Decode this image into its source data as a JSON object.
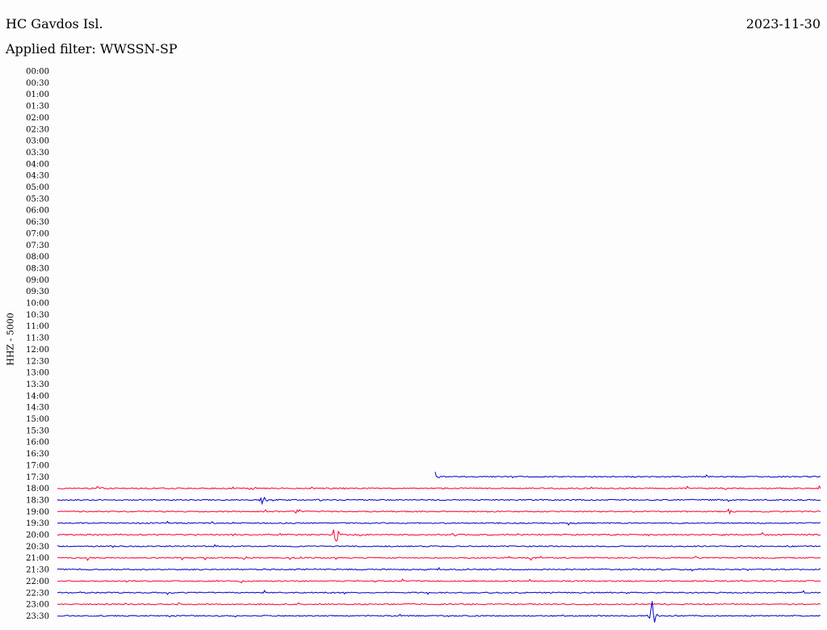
{
  "header": {
    "station": "HC Gavdos Isl.",
    "date": "2023-11-30",
    "filter_text": "Applied filter: WWSSN-SP",
    "channel": "HHZ - 5000"
  },
  "chart_data": {
    "type": "helicorder",
    "y_ticks": [
      "00:00",
      "00:30",
      "01:00",
      "01:30",
      "02:00",
      "02:30",
      "03:00",
      "03:30",
      "04:00",
      "04:30",
      "05:00",
      "05:30",
      "06:00",
      "06:30",
      "07:00",
      "07:30",
      "08:00",
      "08:30",
      "09:00",
      "09:30",
      "10:00",
      "10:30",
      "11:00",
      "11:30",
      "12:00",
      "12:30",
      "13:00",
      "13:30",
      "14:00",
      "14:30",
      "15:00",
      "15:30",
      "16:00",
      "16:30",
      "17:00",
      "17:30",
      "18:00",
      "18:30",
      "19:00",
      "19:30",
      "20:00",
      "20:30",
      "21:00",
      "21:30",
      "22:00",
      "22:30",
      "23:00",
      "23:30"
    ],
    "colors": [
      "#ff0033",
      "#0000cc"
    ],
    "traces": [
      {
        "row": "17:30",
        "start": 0.495,
        "events": [
          {
            "pos": 0.495,
            "amp": 8
          }
        ]
      },
      {
        "row": "18:00",
        "start": 0,
        "events": [
          {
            "pos": 0.054,
            "amp": 3
          },
          {
            "pos": 0.255,
            "amp": 2
          },
          {
            "pos": 0.875,
            "amp": 2
          }
        ]
      },
      {
        "row": "18:30",
        "start": 0,
        "events": [
          {
            "pos": 0.27,
            "amp": 5
          },
          {
            "pos": 0.48,
            "amp": 1
          }
        ]
      },
      {
        "row": "19:00",
        "start": 0,
        "events": [
          {
            "pos": 0.88,
            "amp": 3
          }
        ]
      },
      {
        "row": "19:30",
        "start": 0,
        "events": []
      },
      {
        "row": "20:00",
        "start": 0,
        "events": [
          {
            "pos": 0.365,
            "amp": 11
          },
          {
            "pos": 0.52,
            "amp": 1
          },
          {
            "pos": 0.87,
            "amp": 1
          }
        ]
      },
      {
        "row": "20:30",
        "start": 0,
        "events": []
      },
      {
        "row": "21:00",
        "start": 0,
        "events": []
      },
      {
        "row": "21:30",
        "start": 0,
        "events": [
          {
            "pos": 0.535,
            "amp": 1
          }
        ]
      },
      {
        "row": "22:00",
        "start": 0,
        "events": [
          {
            "pos": 0.24,
            "amp": 2
          }
        ]
      },
      {
        "row": "22:30",
        "start": 0,
        "events": [
          {
            "pos": 0.945,
            "amp": 1
          }
        ]
      },
      {
        "row": "23:00",
        "start": 0,
        "events": [
          {
            "pos": 0.16,
            "amp": 3
          }
        ]
      },
      {
        "row": "23:30",
        "start": 0,
        "events": [
          {
            "pos": 0.78,
            "amp": 20
          }
        ]
      }
    ]
  }
}
